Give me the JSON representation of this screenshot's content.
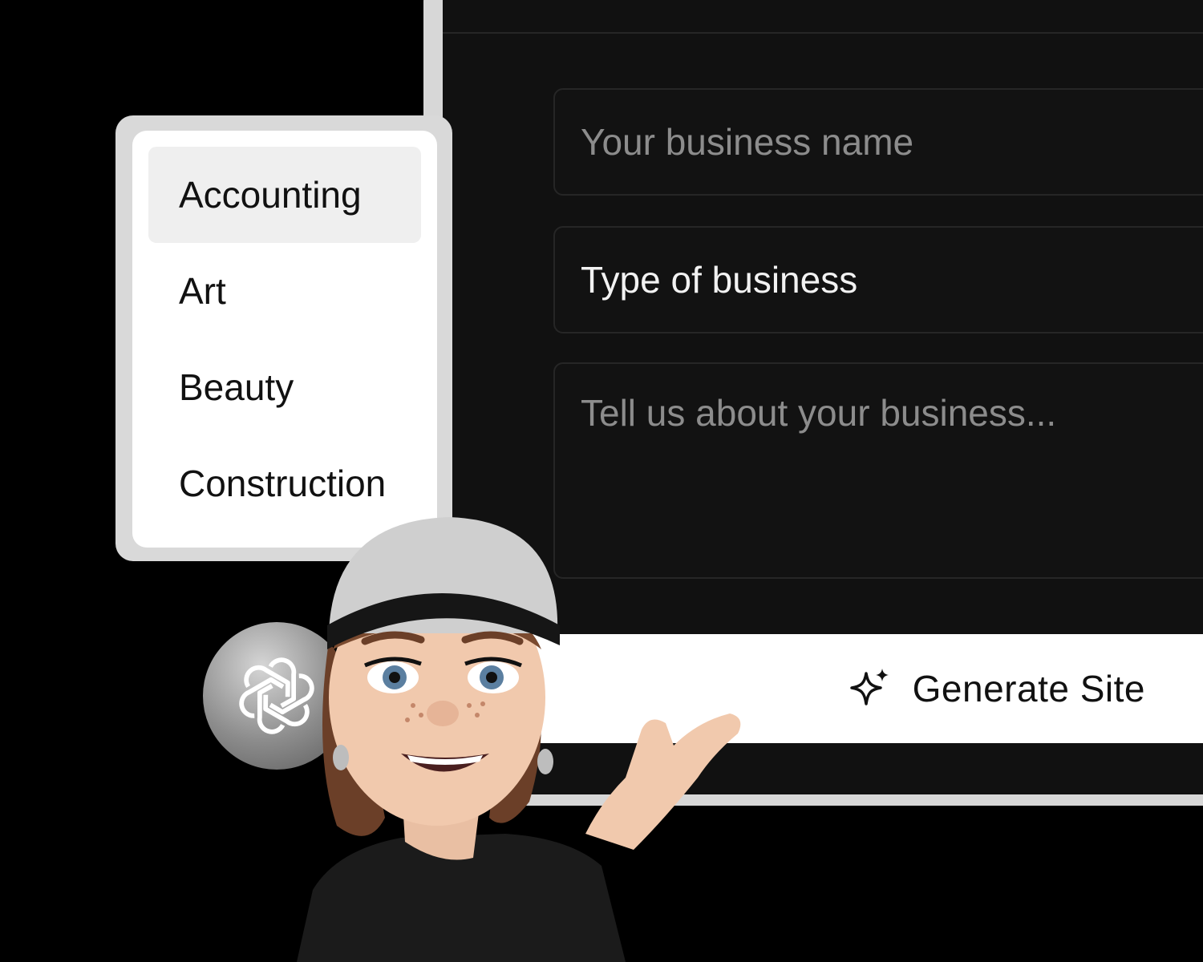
{
  "form": {
    "business_name_placeholder": "Your business name",
    "business_type_value": "Type of business",
    "about_placeholder": "Tell us about your business...",
    "generate_label": "Generate Site"
  },
  "dropdown": {
    "items": [
      "Accounting",
      "Art",
      "Beauty",
      "Construction"
    ],
    "selected": "Accounting"
  },
  "icons": {
    "generate": "sparkle-icon",
    "badge": "openai-logo-icon"
  }
}
